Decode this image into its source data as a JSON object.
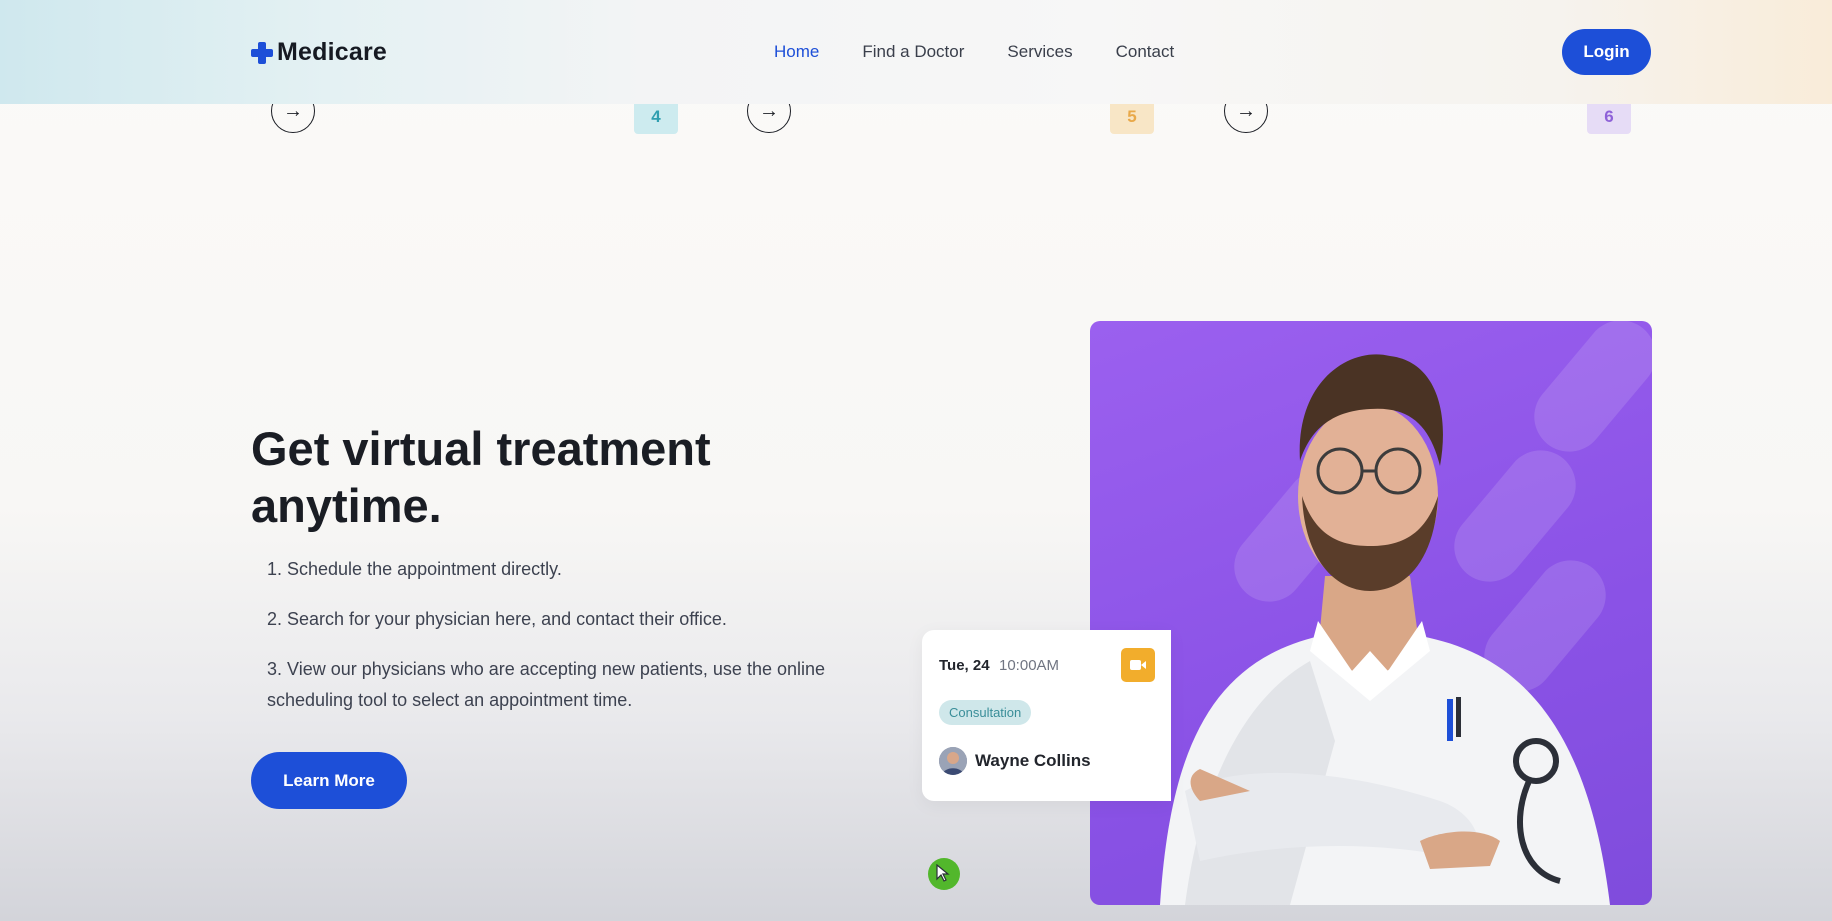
{
  "header": {
    "logo": "Medicare",
    "nav": [
      "Home",
      "Find a Doctor",
      "Services",
      "Contact"
    ],
    "active_nav": "Home",
    "login_label": "Login"
  },
  "steps_strip": {
    "numbers": [
      "4",
      "5",
      "6"
    ],
    "badge_colors": [
      "#cdebef",
      "#f8e6c6",
      "#e6dcf6"
    ],
    "badge_text_colors": [
      "#2f9fb0",
      "#e9a94a",
      "#8e61d8"
    ]
  },
  "hero": {
    "title": "Get virtual treatment anytime.",
    "steps": [
      "1. Schedule the appointment directly.",
      "2. Search for your physician here, and contact their office.",
      "3. View our physicians who are accepting new patients, use the online scheduling tool to select an appointment time."
    ],
    "cta_label": "Learn More"
  },
  "appointment": {
    "date": "Tue, 24",
    "time": "10:00AM",
    "tag": "Consultation",
    "doctor_name": "Wayne Collins"
  },
  "colors": {
    "brand": "#1d4fd8",
    "card_bg": "#9157ea",
    "video_button": "#f2ad2c"
  }
}
